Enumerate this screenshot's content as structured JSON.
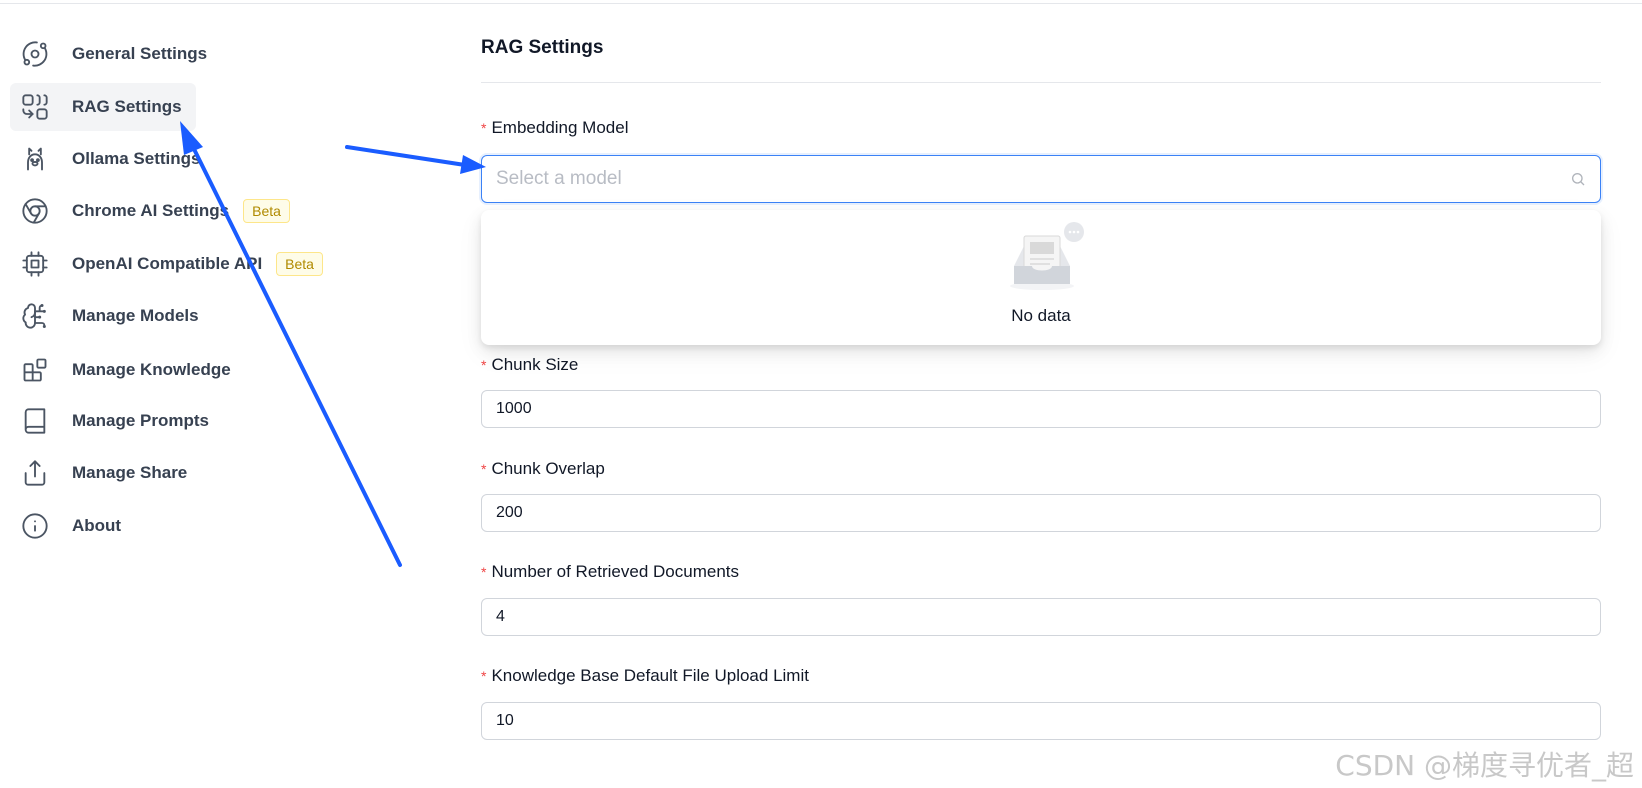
{
  "sidebar": {
    "items": [
      {
        "label": "General Settings",
        "icon": "orbit-icon"
      },
      {
        "label": "RAG Settings",
        "icon": "combine-icon",
        "active": true
      },
      {
        "label": "Ollama Settings",
        "icon": "llama-icon"
      },
      {
        "label": "Chrome AI Settings",
        "icon": "chrome-icon",
        "badge": "Beta"
      },
      {
        "label": "OpenAI Compatible API",
        "icon": "cpu-icon",
        "badge": "Beta"
      },
      {
        "label": "Manage Models",
        "icon": "brain-icon"
      },
      {
        "label": "Manage Knowledge",
        "icon": "blocks-icon"
      },
      {
        "label": "Manage Prompts",
        "icon": "book-icon"
      },
      {
        "label": "Manage Share",
        "icon": "share-icon"
      },
      {
        "label": "About",
        "icon": "info-icon"
      }
    ]
  },
  "main": {
    "title": "RAG Settings",
    "embedding": {
      "label": "Embedding Model",
      "placeholder": "Select a model",
      "dropdown_empty": "No data"
    },
    "fields": [
      {
        "label": "Chunk Size",
        "value": "1000"
      },
      {
        "label": "Chunk Overlap",
        "value": "200"
      },
      {
        "label": "Number of Retrieved Documents",
        "value": "4"
      },
      {
        "label": "Knowledge Base Default File Upload Limit",
        "value": "10"
      }
    ]
  },
  "watermark": "CSDN @梯度寻优者_超",
  "colors": {
    "accent": "#3b82f6",
    "annotation_arrow": "#1a5cff",
    "required": "#ef4444"
  }
}
